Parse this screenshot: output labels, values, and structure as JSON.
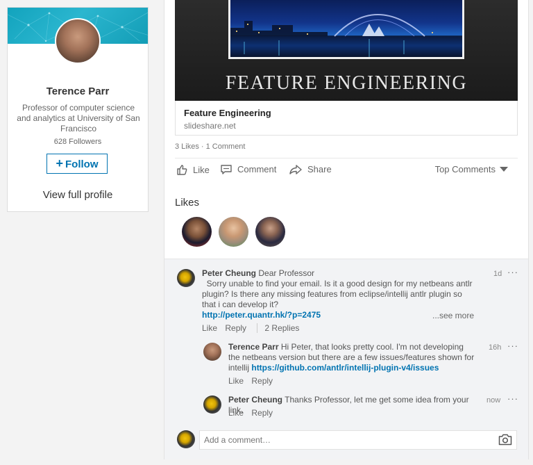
{
  "profile": {
    "name": "Terence Parr",
    "headline": "Professor of computer science and analytics at University of San Francisco",
    "followers": "628 Followers",
    "follow_label": "Follow",
    "view_profile": "View full profile"
  },
  "article": {
    "image_title": "FEATURE ENGINEERING",
    "title": "Feature Engineering",
    "domain": "slideshare.net"
  },
  "social": {
    "counts": "3 Likes · 1 Comment",
    "like": "Like",
    "comment": "Comment",
    "share": "Share",
    "sort": "Top Comments"
  },
  "likes": {
    "heading": "Likes"
  },
  "comments": [
    {
      "author": "Peter Cheung",
      "text_lead": "Dear Professor",
      "text_body": "  Sorry unable to find your email. Is it a good design for my netbeans antlr plugin? Is there any missing features from eclipse/intellij antlr plugin so that i can develop it?",
      "link": "http://peter.quantr.hk/?p=2475",
      "see_more": "...see more",
      "time": "1d",
      "like": "Like",
      "reply": "Reply",
      "replies": "2 Replies"
    }
  ],
  "replies": [
    {
      "author": "Terence Parr",
      "text": "Hi Peter, that looks pretty cool. I'm not developing the netbeans version but there are a few issues/features shown for intellij",
      "link": "https://github.com/antlr/intellij-plugin-v4/issues",
      "time": "16h",
      "like": "Like",
      "reply": "Reply"
    },
    {
      "author": "Peter Cheung",
      "text": "Thanks Professor, let me get some idea from your link.",
      "time": "now",
      "like": "Like",
      "reply": "Reply"
    }
  ],
  "comment_box": {
    "placeholder": "Add a comment…"
  },
  "menu_dots": "···",
  "colors": {
    "brand_blue": "#0073b1",
    "banner_teal": "#1aa9c3",
    "background": "#f3f3f3"
  }
}
